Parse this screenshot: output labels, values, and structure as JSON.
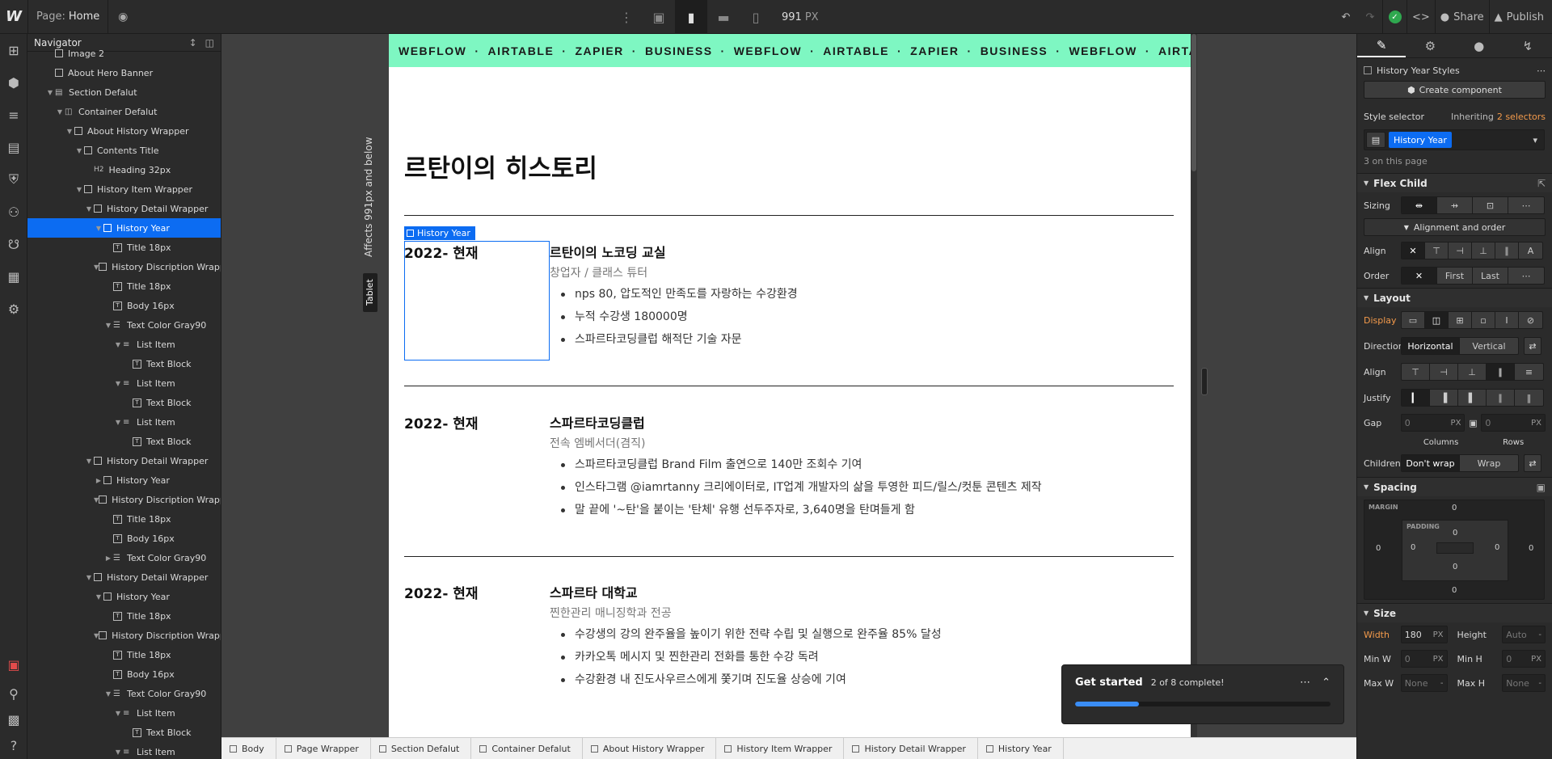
{
  "topbar": {
    "logo": "W",
    "page_label": "Page:",
    "page_name": "Home",
    "width_value": "991",
    "width_unit": "PX",
    "share": "Share",
    "publish": "Publish"
  },
  "navigator": {
    "title": "Navigator",
    "items": [
      {
        "label": "Image 2",
        "icon": "image-icon",
        "depth": 1,
        "type": "box"
      },
      {
        "label": "About Hero Banner",
        "depth": 1,
        "type": "box"
      },
      {
        "label": "Section Defalut",
        "depth": 1,
        "type": "section",
        "caret": true
      },
      {
        "label": "Container Defalut",
        "depth": 2,
        "type": "container",
        "caret": true
      },
      {
        "label": "About History Wrapper",
        "depth": 3,
        "type": "box",
        "caret": true
      },
      {
        "label": "Contents Title",
        "depth": 4,
        "type": "box",
        "caret": true
      },
      {
        "label": "Heading 32px",
        "depth": 5,
        "type": "heading"
      },
      {
        "label": "History Item Wrapper",
        "depth": 4,
        "type": "box",
        "caret": true
      },
      {
        "label": "History Detail Wrapper",
        "depth": 5,
        "type": "box",
        "caret": true
      },
      {
        "label": "History Year",
        "depth": 6,
        "type": "box",
        "caret": true,
        "selected": true
      },
      {
        "label": "Title 18px",
        "depth": 7,
        "type": "text"
      },
      {
        "label": "History Discription Wrapper",
        "depth": 6,
        "type": "box",
        "caret": true
      },
      {
        "label": "Title 18px",
        "depth": 7,
        "type": "text"
      },
      {
        "label": "Body 16px",
        "depth": 7,
        "type": "text"
      },
      {
        "label": "Text Color Gray90",
        "depth": 7,
        "type": "list",
        "caret": true
      },
      {
        "label": "List Item",
        "depth": 8,
        "type": "listitem",
        "caret": true
      },
      {
        "label": "Text Block",
        "depth": 9,
        "type": "text"
      },
      {
        "label": "List Item",
        "depth": 8,
        "type": "listitem",
        "caret": true
      },
      {
        "label": "Text Block",
        "depth": 9,
        "type": "text"
      },
      {
        "label": "List Item",
        "depth": 8,
        "type": "listitem",
        "caret": true
      },
      {
        "label": "Text Block",
        "depth": 9,
        "type": "text"
      },
      {
        "label": "History Detail Wrapper",
        "depth": 5,
        "type": "box",
        "caret": true
      },
      {
        "label": "History Year",
        "depth": 6,
        "type": "box",
        "caret": true,
        "collapsed": true
      },
      {
        "label": "History Discription Wrapper",
        "depth": 6,
        "type": "box",
        "caret": true
      },
      {
        "label": "Title 18px",
        "depth": 7,
        "type": "text"
      },
      {
        "label": "Body 16px",
        "depth": 7,
        "type": "text"
      },
      {
        "label": "Text Color Gray90",
        "depth": 7,
        "type": "list",
        "caret": true,
        "collapsed": true
      },
      {
        "label": "History Detail Wrapper",
        "depth": 5,
        "type": "box",
        "caret": true
      },
      {
        "label": "History Year",
        "depth": 6,
        "type": "box",
        "caret": true
      },
      {
        "label": "Title 18px",
        "depth": 7,
        "type": "text"
      },
      {
        "label": "History Discription Wrapper",
        "depth": 6,
        "type": "box",
        "caret": true
      },
      {
        "label": "Title 18px",
        "depth": 7,
        "type": "text"
      },
      {
        "label": "Body 16px",
        "depth": 7,
        "type": "text"
      },
      {
        "label": "Text Color Gray90",
        "depth": 7,
        "type": "list",
        "caret": true
      },
      {
        "label": "List Item",
        "depth": 8,
        "type": "listitem",
        "caret": true
      },
      {
        "label": "Text Block",
        "depth": 9,
        "type": "text"
      },
      {
        "label": "List Item",
        "depth": 8,
        "type": "listitem",
        "caret": true
      }
    ]
  },
  "canvas": {
    "side_label": "Affects 991px and below",
    "tablet_label": "Tablet",
    "marquee": [
      "WEBFLOW",
      "·",
      "AIRTABLE",
      "·",
      "ZAPIER",
      "·",
      "BUSINESS",
      "·",
      "WEBFLOW",
      "·",
      "AIRTABLE",
      "·",
      "ZAPIER",
      "·",
      "BUSINESS",
      "·",
      "WEBFLOW",
      "·",
      "AIRTABLE"
    ],
    "page_title": "르탄이의 히스토리",
    "selected_tag": "History Year",
    "history": [
      {
        "year": "2022- 현재",
        "company": "르탄이의 노코딩 교실",
        "role": "창업자 / 클래스 튜터",
        "items": [
          "nps 80, 압도적인 만족도를 자랑하는 수강환경",
          "누적 수강생 180000명",
          "스파르타코딩클럽 해적단 기술 자문"
        ]
      },
      {
        "year": "2022- 현재",
        "company": "스파르타코딩클럽",
        "role": "전속 엠베서더(겸직)",
        "items": [
          "스파르타코딩클럽 Brand Film 출연으로 140만 조회수 기여",
          "인스타그램 @iamrtanny 크리에이터로, IT업계 개발자의 삶을 투영한 피드/릴스/컷툰 콘텐츠 제작",
          "말 끝에 '~탄'을 붙이는 '탄체' 유행 선두주자로, 3,640명을 탄며들게 함"
        ]
      },
      {
        "year": "2022- 현재",
        "company": "스파르타 대학교",
        "role": "찐한관리 매니징학과 전공",
        "items": [
          "수강생의 강의 완주율을 높이기 위한 전략 수립 및 실행으로 완주율 85% 달성",
          "카카오톡 메시지 및 찐한관리 전화를 통한 수강 독려",
          "수강환경 내 진도사우르스에게 쫓기며 진도율 상승에 기여"
        ]
      }
    ]
  },
  "get_started": {
    "title": "Get started",
    "progress_text": "2 of 8 complete!",
    "progress_fraction": 0.25
  },
  "breadcrumb": [
    "Body",
    "Page Wrapper",
    "Section Defalut",
    "Container Defalut",
    "About History Wrapper",
    "History Item Wrapper",
    "History Detail Wrapper",
    "History Year"
  ],
  "style_panel": {
    "element_name": "History Year Styles",
    "create_component": "Create component",
    "style_selector_label": "Style selector",
    "inheriting_prefix": "Inheriting",
    "inheriting_count": "2 selectors",
    "selector_token": "History Year",
    "on_page": "3 on this page",
    "flex_child": {
      "title": "Flex Child",
      "sizing_label": "Sizing",
      "alignment_order": "Alignment and order",
      "align_label": "Align",
      "order_label": "Order",
      "order_first": "First",
      "order_last": "Last"
    },
    "layout": {
      "title": "Layout",
      "display_label": "Display",
      "direction_label": "Direction",
      "direction_horizontal": "Horizontal",
      "direction_vertical": "Vertical",
      "align_label": "Align",
      "justify_label": "Justify",
      "gap_label": "Gap",
      "gap_columns": "0",
      "gap_rows": "0",
      "gap_unit": "PX",
      "columns_label": "Columns",
      "rows_label": "Rows",
      "children_label": "Children",
      "dont_wrap": "Don't wrap",
      "wrap": "Wrap"
    },
    "spacing": {
      "title": "Spacing",
      "margin_label": "MARGIN",
      "padding_label": "PADDING",
      "margin_top": "0",
      "margin_right": "0",
      "margin_bottom": "0",
      "margin_left": "0",
      "padding_top": "0",
      "padding_right": "0",
      "padding_bottom": "0",
      "padding_left": "0"
    },
    "size": {
      "title": "Size",
      "width_label": "Width",
      "width_value": "180",
      "width_unit": "PX",
      "height_label": "Height",
      "height_value": "Auto",
      "minw_label": "Min W",
      "minw_value": "0",
      "minh_label": "Min H",
      "minh_value": "0",
      "maxw_label": "Max W",
      "maxw_value": "None",
      "maxh_label": "Max H",
      "maxh_value": "None",
      "unit_px": "PX",
      "unit_dash": "-"
    }
  }
}
